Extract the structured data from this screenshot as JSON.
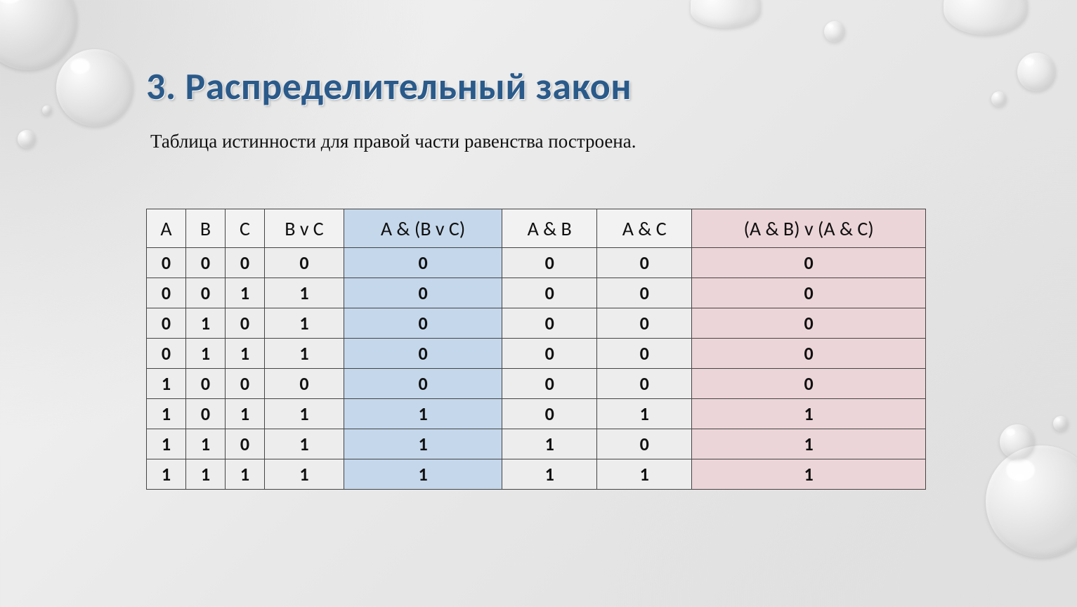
{
  "title": "3. Распределительный закон",
  "subtitle": "Таблица истинности для правой части равенства построена.",
  "headers": [
    "A",
    "B",
    "C",
    "B v C",
    "A & (B v C)",
    "A & B",
    "A & C",
    "(A & B) v (A & C)"
  ],
  "rows": [
    [
      "0",
      "0",
      "0",
      "0",
      "0",
      "0",
      "0",
      "0"
    ],
    [
      "0",
      "0",
      "1",
      "1",
      "0",
      "0",
      "0",
      "0"
    ],
    [
      "0",
      "1",
      "0",
      "1",
      "0",
      "0",
      "0",
      "0"
    ],
    [
      "0",
      "1",
      "1",
      "1",
      "0",
      "0",
      "0",
      "0"
    ],
    [
      "1",
      "0",
      "0",
      "0",
      "0",
      "0",
      "0",
      "0"
    ],
    [
      "1",
      "0",
      "1",
      "1",
      "1",
      "0",
      "1",
      "1"
    ],
    [
      "1",
      "1",
      "0",
      "1",
      "1",
      "1",
      "0",
      "1"
    ],
    [
      "1",
      "1",
      "1",
      "1",
      "1",
      "1",
      "1",
      "1"
    ]
  ],
  "highlight": {
    "blue_col": 4,
    "pink_col": 7
  }
}
